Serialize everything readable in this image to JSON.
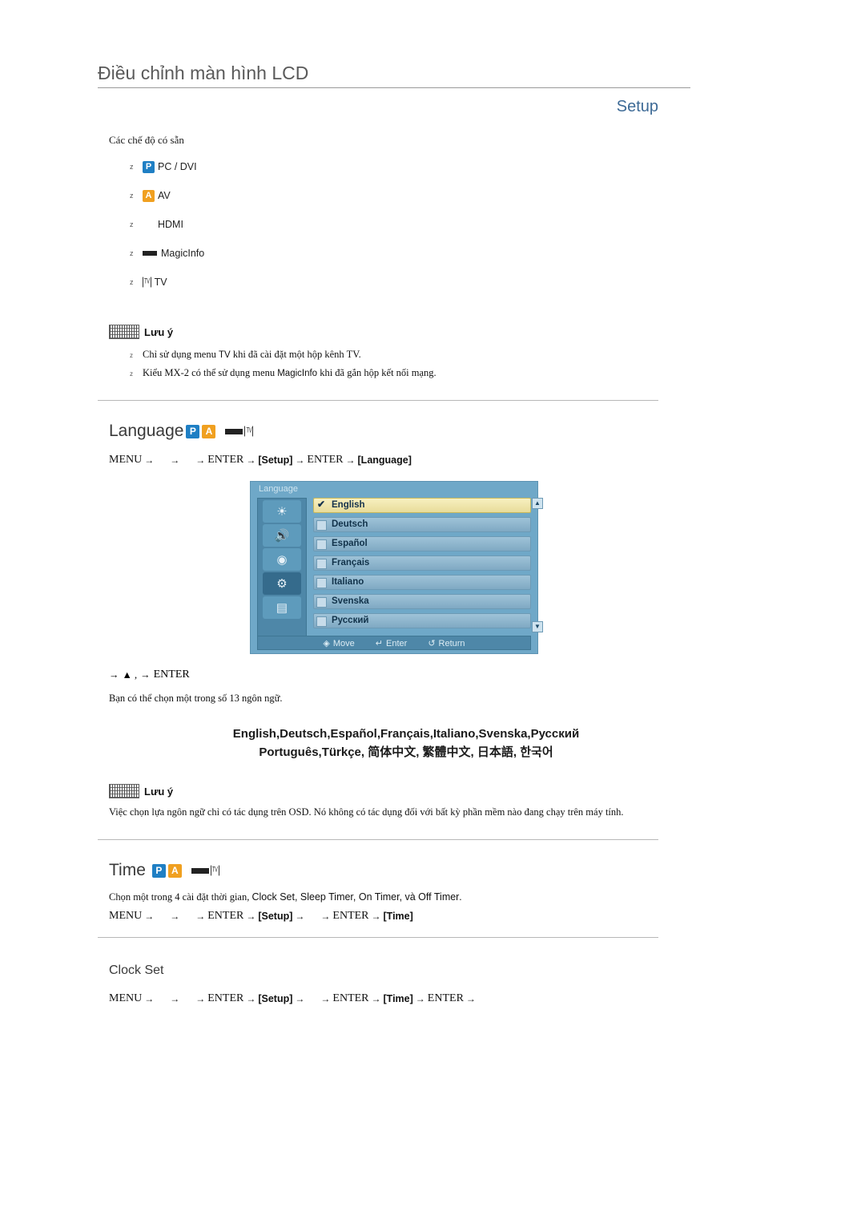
{
  "header": {
    "title": "Điều chỉnh màn hình LCD",
    "section": "Setup"
  },
  "available_modes": {
    "heading": "Các chế độ có sẵn",
    "items": [
      {
        "chip": "P",
        "chip_type": "p",
        "label": "PC / DVI"
      },
      {
        "chip": "A",
        "chip_type": "a",
        "label": "AV"
      },
      {
        "chip": "",
        "chip_type": "hdmi",
        "label": "HDMI"
      },
      {
        "chip": "",
        "chip_type": "magicinfo",
        "label": "MagicInfo"
      },
      {
        "chip": "TV",
        "chip_type": "tv",
        "label": "TV"
      }
    ]
  },
  "note1": {
    "title": "Lưu ý",
    "items": [
      {
        "pre": "Chỉ sử dụng menu ",
        "kw": "TV",
        "post": " khi đã cài đặt một hộp kênh TV."
      },
      {
        "pre": "Kiểu MX-2 có thể sử dụng menu ",
        "kw": "MagicInfo",
        "post": " khi đã gắn hộp kết nối mạng."
      }
    ]
  },
  "language_section": {
    "title": "Language",
    "path": {
      "start": "MENU",
      "enter": "ENTER",
      "setup": "[Setup]",
      "target": "[Language]"
    },
    "osd": {
      "title": "Language",
      "icons": [
        "picture-icon",
        "sound-icon",
        "input-icon",
        "setup-icon",
        "multi-control-icon"
      ],
      "selected_icon_index": 3,
      "rows": [
        {
          "label": "English",
          "selected": true
        },
        {
          "label": "Deutsch",
          "selected": false
        },
        {
          "label": "Español",
          "selected": false
        },
        {
          "label": "Français",
          "selected": false
        },
        {
          "label": "Italiano",
          "selected": false
        },
        {
          "label": "Svenska",
          "selected": false
        },
        {
          "label": "Русский",
          "selected": false
        }
      ],
      "footer": [
        {
          "icon": "◈",
          "label": "Move"
        },
        {
          "icon": "↵",
          "label": "Enter"
        },
        {
          "icon": "↺",
          "label": "Return"
        }
      ],
      "scroll_up": "▲",
      "scroll_down": "▼"
    },
    "after_path": {
      "arrow1": "→",
      "updown": "▲ ,",
      "arrow2": "→",
      "enter": "ENTER"
    },
    "description": "Bạn có thể chọn một trong số 13 ngôn ngữ.",
    "languages_line1": "English,Deutsch,Español,Français,Italiano,Svenska,Русский",
    "languages_line2": "Português,Türkçe, 简体中文,  繁體中文, 日本語, 한국어",
    "note": {
      "title": "Lưu ý",
      "text": "Việc chọn lựa ngôn ngữ chỉ có tác dụng trên OSD. Nó không có tác dụng đối với bất kỳ phần mềm nào đang chạy trên máy tính."
    }
  },
  "time_section": {
    "title": "Time",
    "intro_pre": "Chọn một trong 4 cài đặt thời gian, ",
    "intro_items": "Clock Set, Sleep Timer, On Timer, và Off Timer",
    "intro_post": ".",
    "path": {
      "start": "MENU",
      "enter": "ENTER",
      "setup": "[Setup]",
      "target": "[Time]"
    },
    "clock_set": {
      "title": "Clock Set",
      "path": {
        "start": "MENU",
        "enter": "ENTER",
        "setup": "[Setup]",
        "target": "[Time]",
        "final_enter": "ENTER"
      }
    }
  }
}
